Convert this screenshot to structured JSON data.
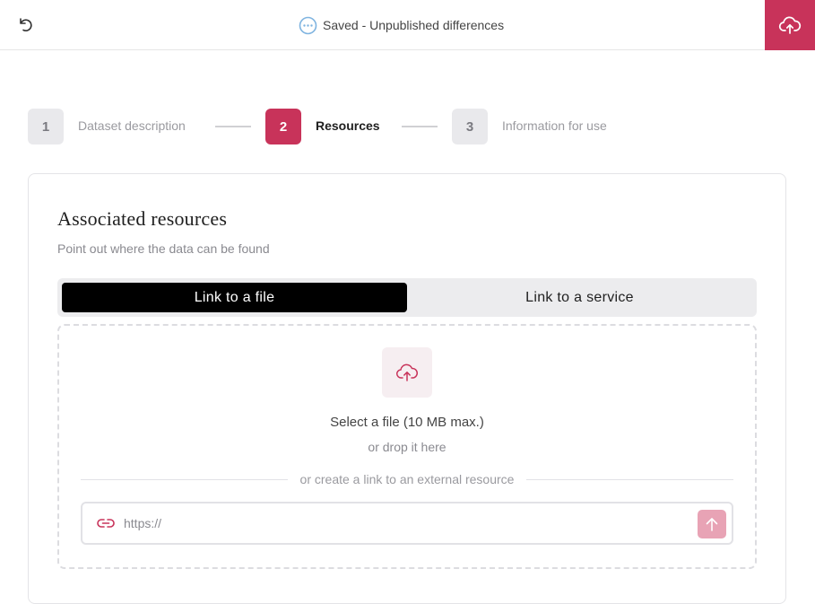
{
  "header": {
    "status_text": "Saved - Unpublished differences",
    "accent_color": "#c8335a"
  },
  "stepper": {
    "steps": [
      {
        "number": "1",
        "label": "Dataset description",
        "state": "inactive"
      },
      {
        "number": "2",
        "label": "Resources",
        "state": "active"
      },
      {
        "number": "3",
        "label": "Information for use",
        "state": "inactive"
      }
    ]
  },
  "card": {
    "title": "Associated resources",
    "subtitle": "Point out where the data can be found"
  },
  "tabs": [
    {
      "label": "Link to a file",
      "selected": true
    },
    {
      "label": "Link to a service",
      "selected": false
    }
  ],
  "dropzone": {
    "select_file": "Select a file (10 MB max.)",
    "drop_hint": "or drop it here",
    "divider_text": "or create a link to an external resource",
    "url_placeholder": "https://",
    "url_value": ""
  },
  "icons": {
    "undo": "undo-icon",
    "status": "dots-circle-icon",
    "publish": "cloud-upload-icon",
    "upload": "cloud-upload-icon",
    "link": "link-icon",
    "submit": "arrow-up-icon"
  }
}
